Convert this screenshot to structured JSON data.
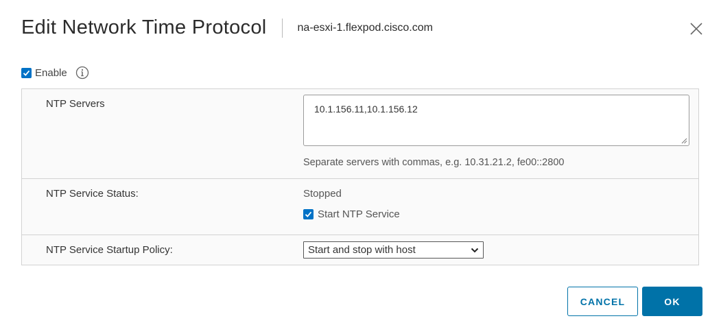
{
  "dialog": {
    "title": "Edit Network Time Protocol",
    "host": "na-esxi-1.flexpod.cisco.com"
  },
  "enable": {
    "label": "Enable",
    "checked": true
  },
  "ntp_servers": {
    "label": "NTP Servers",
    "value": "10.1.156.11,10.1.156.12",
    "hint": "Separate servers with commas, e.g. 10.31.21.2, fe00::2800"
  },
  "service_status": {
    "label": "NTP Service Status:",
    "status": "Stopped",
    "start_label": "Start NTP Service",
    "start_checked": true
  },
  "startup_policy": {
    "label": "NTP Service Startup Policy:",
    "selected": "Start and stop with host"
  },
  "buttons": {
    "cancel": "CANCEL",
    "ok": "OK"
  },
  "colors": {
    "accent": "#0072a8",
    "checkbox": "#0072c6",
    "panel_bg": "#fafafa",
    "border": "#d2d2d2"
  },
  "icons": {
    "close": "close-icon",
    "info": "info-icon",
    "chevron": "chevron-down-icon",
    "check": "checkmark-icon"
  }
}
